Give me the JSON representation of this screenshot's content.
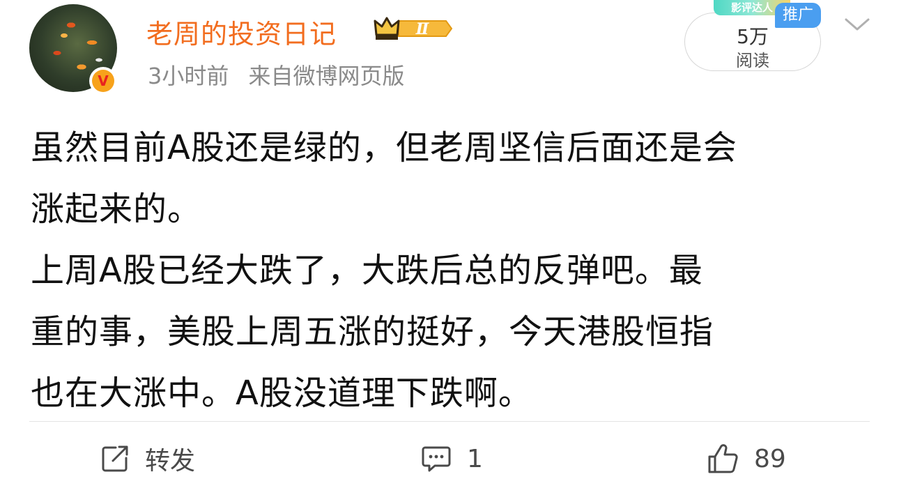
{
  "post": {
    "author": "老周的投资日记",
    "level_badge": "Ⅱ",
    "time": "3小时前",
    "source": "来自微博网页版",
    "verified_mark": "V",
    "read_count": "5万",
    "read_label": "阅读",
    "sticker_text": "影评达人",
    "promo_tag": "推广",
    "content": [
      "虽然目前A股还是绿的，但老周坚信后面还是会",
      "涨起来的。",
      "上周A股已经大跌了，大跌后总的反弹吧。最",
      "重的事，美股上周五涨的挺好，今天港股恒指",
      "也在大涨中。A股没道理下跌啊。"
    ]
  },
  "actions": {
    "repost_label": "转发",
    "comment_count": "1",
    "like_count": "89"
  },
  "colors": {
    "username": "#f26d1f",
    "meta": "#8a8a8a",
    "promo": "#4a9ef0"
  },
  "icons": [
    "crown-icon",
    "verified-icon",
    "chevron-down-icon",
    "repost-icon",
    "comment-icon",
    "like-icon"
  ]
}
